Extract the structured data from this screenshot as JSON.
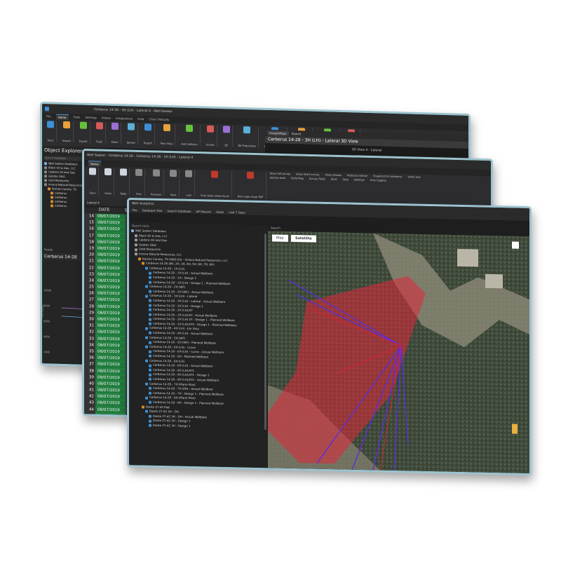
{
  "app": {
    "name": "Well Seeker"
  },
  "back_window": {
    "title": "Cerberus 14-28 - 3H (LH) - Lateral 4 - Well Seeker",
    "tabs": [
      "File",
      "Home",
      "Tools",
      "Settings",
      "Videos",
      "Integrations",
      "Help",
      "Chart Defaults"
    ],
    "active_tab": "Home",
    "ribbon_groups": [
      "Controls",
      "Database",
      "Data Exchange",
      "Sensor Reports",
      "Well Plots"
    ],
    "ribbon_buttons": [
      "Save",
      "Import",
      "Export",
      "Push",
      "Fetch",
      "Sensor",
      "Report",
      "Plan View",
      "Anti-Collision",
      "Charts",
      "3D",
      "Bit Projections",
      "Report Manager",
      "Surface Plots",
      "Daily Reporting",
      "Analytics"
    ],
    "object_explorer_title": "Object Explorer",
    "search_label": "Search Database",
    "tree_items": [
      "Well Seeker Database",
      "Black Oil & Gas, LLC",
      "Caldera Oil and Gas",
      "Geotex O&G",
      "Gold Resources",
      "Innova Natural Resources",
      "Karnes County, TX",
      "Cerberus",
      "Cerberus",
      "Cerberus",
      "Cerberus"
    ],
    "status": "Ready",
    "bottom_tab": "Cerberus 14-28",
    "chart_axis_values": [
      "10000",
      "8000",
      "6000",
      "4000",
      "2000"
    ],
    "chart_ylabel": "TVD (usft)",
    "view_title": "Cerberus 14-28 - 3H (LH) - Lateral 3D View",
    "view_subtitle": "3D View 4 - Lateral",
    "gm_button": "GoogleMaps",
    "gm_search": "Search"
  },
  "middle_window": {
    "title": "Well Seeker - Cerberus 14-28 - Cerberus 14-28 - 3H (LH) - Lateral 4",
    "ribbon_group_labels": [
      "File",
      "Navigation",
      "Tools",
      "Options",
      "Grid Options",
      "Grid Display",
      "WITS",
      "Excel",
      "WITS Survey",
      "Scientific"
    ],
    "buttons": [
      "Save",
      "Undo",
      "Redo",
      "First",
      "Previous",
      "Next",
      "Last",
      "Print Slide Sheet Excel",
      "Print slide sheet PDF"
    ],
    "checkboxes": [
      "Show full survey",
      "Show short survey",
      "Show phases",
      "Reduced station",
      "Snapshot for submerry",
      "Verify tool",
      "Section data",
      "Build Map",
      "Survey Table",
      "Start",
      "Stop",
      "Settings",
      "Over logging"
    ],
    "grid_header": {
      "date": "DATE",
      "rest": "ST..."
    },
    "lateral_label": "Lateral 4",
    "rows": [
      {
        "num": "14",
        "date": "08/07/2019"
      },
      {
        "num": "15",
        "date": "08/07/2019"
      },
      {
        "num": "16",
        "date": "08/07/2019"
      },
      {
        "num": "17",
        "date": "08/07/2019"
      },
      {
        "num": "18",
        "date": "08/07/2019"
      },
      {
        "num": "19",
        "date": "08/07/2019"
      },
      {
        "num": "20",
        "date": "08/07/2019"
      },
      {
        "num": "21",
        "date": "08/07/2019"
      },
      {
        "num": "22",
        "date": "08/07/2019"
      },
      {
        "num": "23",
        "date": "08/07/2019"
      },
      {
        "num": "24",
        "date": "08/07/2019"
      },
      {
        "num": "25",
        "date": "08/07/2019"
      },
      {
        "num": "26",
        "date": "08/07/2019"
      },
      {
        "num": "27",
        "date": "08/07/2019"
      },
      {
        "num": "28",
        "date": "08/07/2019"
      },
      {
        "num": "29",
        "date": "08/07/2019"
      },
      {
        "num": "30",
        "date": "08/07/2019"
      },
      {
        "num": "31",
        "date": "08/07/2019"
      },
      {
        "num": "32",
        "date": "08/07/2019"
      },
      {
        "num": "33",
        "date": "08/07/2019"
      },
      {
        "num": "34",
        "date": "08/07/2019"
      },
      {
        "num": "35",
        "date": "08/07/2019"
      },
      {
        "num": "36",
        "date": "08/07/2019"
      },
      {
        "num": "37",
        "date": "08/07/2019"
      },
      {
        "num": "38",
        "date": "08/07/2019"
      },
      {
        "num": "39",
        "date": "08/07/2019"
      },
      {
        "num": "40",
        "date": "08/07/2019"
      },
      {
        "num": "41",
        "date": "08/07/2019"
      },
      {
        "num": "42",
        "date": "08/07/2019"
      },
      {
        "num": "43",
        "date": "08/07/2019"
      },
      {
        "num": "44",
        "date": "08/07/2019"
      },
      {
        "num": "45",
        "date": "08/07/2019"
      },
      {
        "num": "46",
        "date": "08/07/2019"
      }
    ]
  },
  "front_window": {
    "title": "Well Analytics",
    "menu": [
      "File",
      "Database Tree",
      "Search Database",
      "API Recent",
      "Goals",
      "Last 7 Days"
    ],
    "search_label": "Search tools",
    "map_tabs": [
      "Map",
      "Satellite"
    ],
    "map_active_tab": "Satellite",
    "map_header": "Search",
    "tree": [
      {
        "indent": 0,
        "label": "Well Seeker Database",
        "color": "#7fb4e8"
      },
      {
        "indent": 1,
        "label": "Black Oil & Gas, LLC",
        "color": "#9a9a9a"
      },
      {
        "indent": 1,
        "label": "Caldera Oil and Gas",
        "color": "#9a9a9a"
      },
      {
        "indent": 1,
        "label": "Geotex O&G",
        "color": "#9a9a9a"
      },
      {
        "indent": 1,
        "label": "Gold Resources",
        "color": "#9a9a9a"
      },
      {
        "indent": 1,
        "label": "Innova Natural Resources, LLC",
        "color": "#9a9a9a"
      },
      {
        "indent": 2,
        "label": "Karnes County, TX (NAD 83) - Innova Natural Resources, LLC",
        "color": "#d98c2c"
      },
      {
        "indent": 3,
        "label": "Cerberus 14-28 (9H, 2H, 3H, 4H, 5H, 6H, 7H, 8H)",
        "color": "#d98c2c"
      },
      {
        "indent": 4,
        "label": "Cerberus 14-28 - 1H (LH)",
        "color": "#3d8fd6"
      },
      {
        "indent": 5,
        "label": "Cerberus 14-28 - 1H (LH) - Actual Wellbore",
        "color": "#3d8fd6"
      },
      {
        "indent": 5,
        "label": "Cerberus 14-28 - 1H - Design 1",
        "color": "#3d8fd6"
      },
      {
        "indent": 5,
        "label": "Cerberus 14-28 - 1H (LH) - Design 1 - Planned Wellbore",
        "color": "#3d8fd6"
      },
      {
        "indent": 4,
        "label": "Cerberus 14-28 - 2H (WF)",
        "color": "#3d8fd6"
      },
      {
        "indent": 5,
        "label": "Cerberus 14-28 - 2H (WF) - Actual Wellbore",
        "color": "#3d8fd6"
      },
      {
        "indent": 4,
        "label": "Cerberus 14-28 - 3H (LH) - Lateral",
        "color": "#3d8fd6"
      },
      {
        "indent": 5,
        "label": "Cerberus 14-28 - 3H (LH) - Lateral - Actual Wellbore",
        "color": "#3d8fd6"
      },
      {
        "indent": 5,
        "label": "Cerberus 14-28 - 3H (LH) - Design 1",
        "color": "#3d8fd6"
      },
      {
        "indent": 5,
        "label": "Cerberus 14-28 - 3H (LH)/ST",
        "color": "#3d8fd6"
      },
      {
        "indent": 5,
        "label": "Cerberus 14-28 - 3H (LH)/ST - Actual Wellbore",
        "color": "#3d8fd6"
      },
      {
        "indent": 5,
        "label": "Cerberus 14-28 - 3H (LH) ST - Design 1 - Planned Wellbore",
        "color": "#3d8fd6"
      },
      {
        "indent": 5,
        "label": "Cerberus 14-28 - 3H (LH)/ST2 - Design 1 - Planned Wellbore",
        "color": "#3d8fd6"
      },
      {
        "indent": 4,
        "label": "Cerberus 14-28 - 4H (LH) - Jim Only",
        "color": "#3d8fd6"
      },
      {
        "indent": 5,
        "label": "Cerberus 14-28 - 4H (LH) - Actual Wellbore",
        "color": "#3d8fd6"
      },
      {
        "indent": 4,
        "label": "Cerberus 14-28 - 5H (WF)",
        "color": "#3d8fd6"
      },
      {
        "indent": 5,
        "label": "Cerberus 14-28 - 5H (WF) - Planned Wellbore",
        "color": "#3d8fd6"
      },
      {
        "indent": 4,
        "label": "Cerberus 14-28 - 6H (LH) - Curve",
        "color": "#3d8fd6"
      },
      {
        "indent": 5,
        "label": "Cerberus 14-28 - 6H (LH) - Curve - Actual Wellbore",
        "color": "#3d8fd6"
      },
      {
        "indent": 5,
        "label": "Cerberus 14-28 - 6H - Planned Wellbore",
        "color": "#3d8fd6"
      },
      {
        "indent": 4,
        "label": "Cerberus 14-28 - 8H (LH)",
        "color": "#3d8fd6"
      },
      {
        "indent": 5,
        "label": "Cerberus 14-28 - 8H (LH) - Actual Wellbore",
        "color": "#3d8fd6"
      },
      {
        "indent": 5,
        "label": "Cerberus 14-28 - 8H (LH)/ST1",
        "color": "#3d8fd6"
      },
      {
        "indent": 5,
        "label": "Cerberus 14-28 - 8H (LH)/ST1 - Design 1",
        "color": "#3d8fd6"
      },
      {
        "indent": 5,
        "label": "Cerberus 14-28 - 8H (LH)/ST2 - Actual Wellbore",
        "color": "#3d8fd6"
      },
      {
        "indent": 4,
        "label": "Cerberus 14-28 - 7H (Plane Plan)",
        "color": "#3d8fd6"
      },
      {
        "indent": 5,
        "label": "Cerberus 14-28 - 7H (PD) - Actual Wellbore",
        "color": "#3d8fd6"
      },
      {
        "indent": 5,
        "label": "Cerberus 14-28 - 7H - Design 1 - Planned Wellbore",
        "color": "#3d8fd6"
      },
      {
        "indent": 4,
        "label": "Cerberus 14-28 - 9H (Plane Plan)",
        "color": "#3d8fd6"
      },
      {
        "indent": 5,
        "label": "Cerberus 14-28 - 9H - Design 1 - Planned Wellbore",
        "color": "#3d8fd6"
      },
      {
        "indent": 3,
        "label": "Dante 27-42 Pad",
        "color": "#d98c2c"
      },
      {
        "indent": 4,
        "label": "Dante 27-42 3H - DH",
        "color": "#3d8fd6"
      },
      {
        "indent": 5,
        "label": "Dante 27-42 3H - DH - Actual Wellbore",
        "color": "#3d8fd6"
      },
      {
        "indent": 5,
        "label": "Dante 27-42 3H - Design 1",
        "color": "#3d8fd6"
      },
      {
        "indent": 5,
        "label": "Dante 27-42 3H - Design 1",
        "color": "#3d8fd6"
      }
    ]
  },
  "colors": {
    "frame": "#9cc3cf",
    "grid_date": "#1f7a3c",
    "polygon": "#e0283a",
    "wellpath": "#5a2fd8"
  }
}
